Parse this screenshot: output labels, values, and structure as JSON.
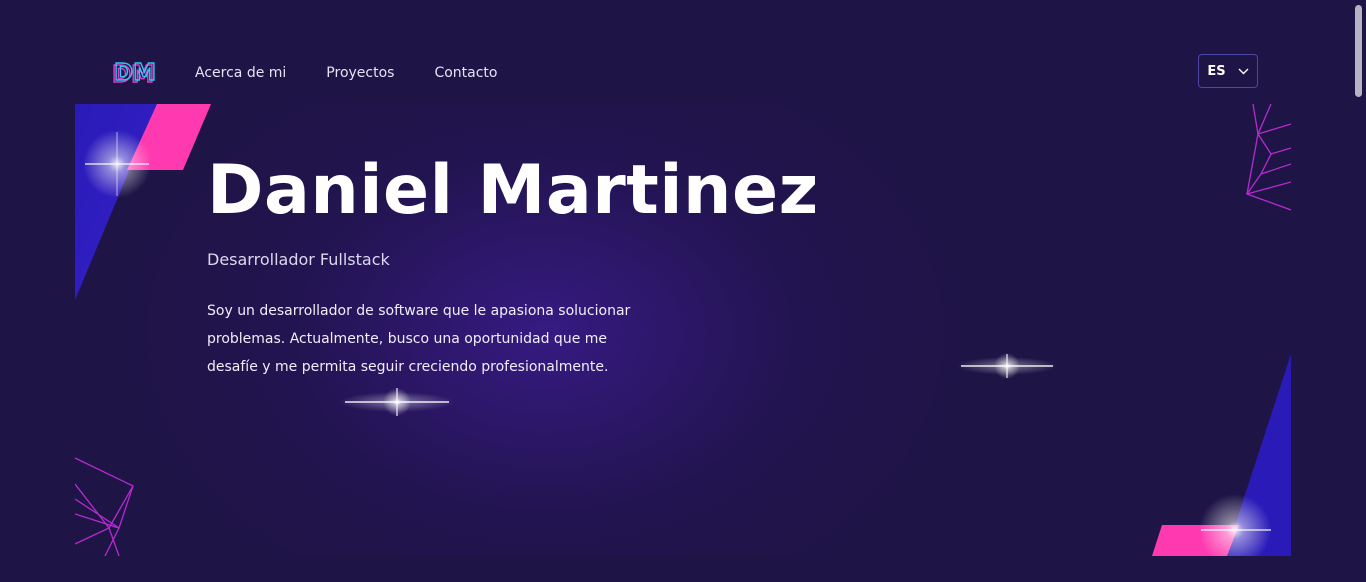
{
  "brand": {
    "logo_text": "DM",
    "logo_colors": [
      "#e23bd0",
      "#2ec9f2"
    ]
  },
  "nav": {
    "items": [
      {
        "label": "Acerca de mi"
      },
      {
        "label": "Proyectos"
      },
      {
        "label": "Contacto"
      }
    ]
  },
  "language": {
    "selected": "ES",
    "icon": "chevron-down-icon"
  },
  "hero": {
    "name": "Daniel Martinez",
    "role": "Desarrollador Fullstack",
    "bio": "Soy un desarrollador de software que le apasiona solucionar problemas. Actualmente, busco una oportunidad que me desafíe y me permita seguir creciendo profesionalmente."
  },
  "colors": {
    "background": "#1f1446",
    "accent_pink": "#ff3ab0",
    "accent_blue": "#2a1bb8",
    "line_purple": "#b52bd1"
  }
}
